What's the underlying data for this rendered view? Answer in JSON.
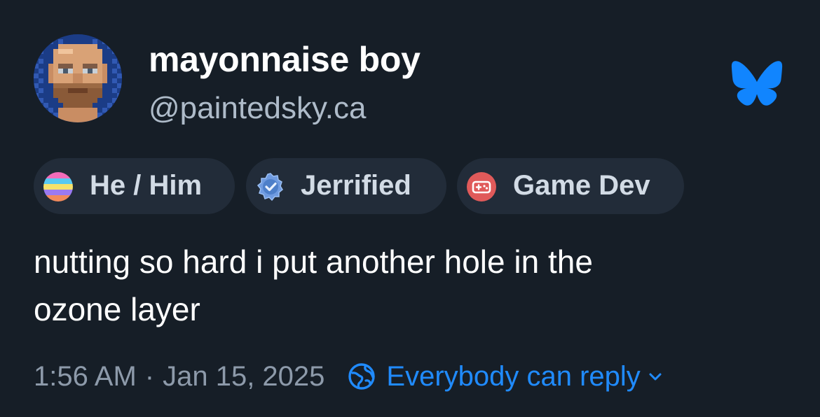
{
  "post": {
    "author": {
      "display_name": "mayonnaise boy",
      "handle": "@paintedsky.ca",
      "avatar_icon": "pixel-art-bald-man-avatar"
    },
    "app_logo_icon": "bluesky-butterfly-icon",
    "badges": [
      {
        "label": "He / Him",
        "icon": "pronouns-flag-icon"
      },
      {
        "label": "Jerrified",
        "icon": "verified-seal-icon"
      },
      {
        "label": "Game Dev",
        "icon": "gamepad-icon"
      }
    ],
    "text": "nutting so hard i put another hole in the\nozone layer",
    "time": "1:56 AM",
    "separator": "·",
    "date": "Jan 15, 2025",
    "reply_setting": "Everybody can reply",
    "colors": {
      "background": "#161e27",
      "badge_bg": "#222c39",
      "accent_blue": "#208bfe",
      "muted_text": "#8d9aaa"
    }
  }
}
